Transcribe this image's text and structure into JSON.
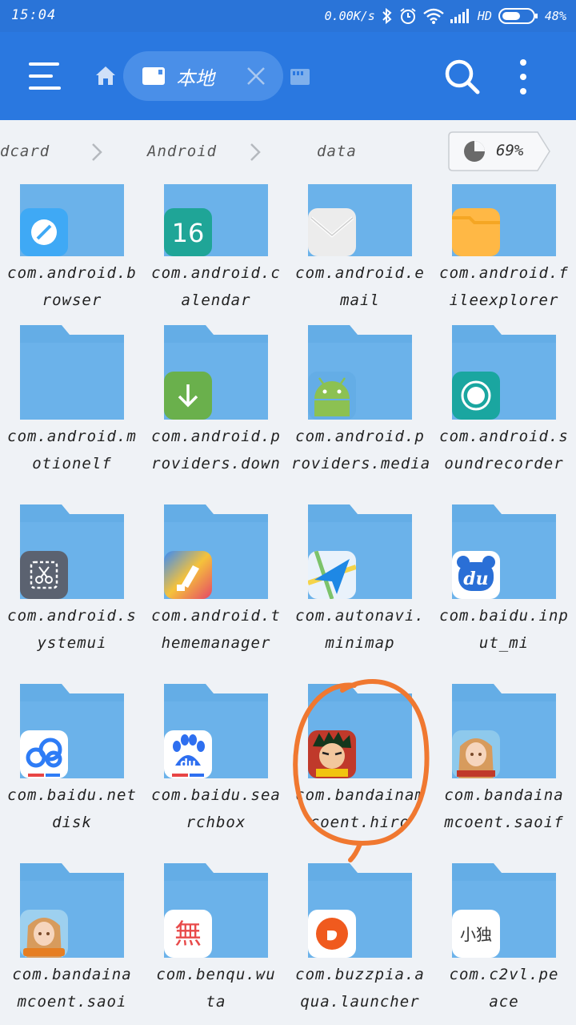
{
  "status_bar": {
    "time": "15:04",
    "speed": "0.00K/s",
    "hd": "HD",
    "battery": "48%"
  },
  "toolbar": {
    "tab_label": "本地"
  },
  "breadcrumb": {
    "items": [
      "dcard",
      "Android",
      "data"
    ],
    "usage": "69%"
  },
  "colors": {
    "toolbar": "#2a78e0",
    "status_bar": "#2a74d8",
    "folder": "#64ade6",
    "background": "#eff2f6",
    "annotation": "#f07830"
  },
  "folders": [
    {
      "line1": "com.android.b",
      "line2": "rowser",
      "icon": "browser-icon"
    },
    {
      "line1": "com.android.c",
      "line2": "alendar",
      "icon": "calendar-icon",
      "icon_text": "16"
    },
    {
      "line1": "com.android.e",
      "line2": "mail",
      "icon": "email-icon"
    },
    {
      "line1": "com.android.f",
      "line2": "ileexplorer",
      "icon": "file-explorer-icon"
    },
    {
      "line1": "com.android.m",
      "line2": "otionelf",
      "icon": "none"
    },
    {
      "line1": "com.android.p",
      "line2": "roviders.down",
      "icon": "download-icon"
    },
    {
      "line1": "com.android.p",
      "line2": "roviders.media",
      "icon": "android-robot-icon"
    },
    {
      "line1": "com.android.s",
      "line2": "oundrecorder",
      "icon": "sound-recorder-icon"
    },
    {
      "line1": "com.android.s",
      "line2": "ystemui",
      "icon": "screenshot-scissors-icon"
    },
    {
      "line1": "com.android.t",
      "line2": "hememanager",
      "icon": "theme-manager-icon"
    },
    {
      "line1": "com.autonavi.",
      "line2": "minimap",
      "icon": "amap-navigation-icon"
    },
    {
      "line1": "com.baidu.inp",
      "line2": "ut_mi",
      "icon": "baidu-input-icon",
      "icon_text": "du"
    },
    {
      "line1": "com.baidu.net",
      "line2": "disk",
      "icon": "baidu-netdisk-icon"
    },
    {
      "line1": "com.baidu.sea",
      "line2": "rchbox",
      "icon": "baidu-search-icon",
      "icon_text": "du"
    },
    {
      "line1": "com.bandainam",
      "line2": "coent.hiro",
      "icon": "anime-hero-game-icon"
    },
    {
      "line1": "com.bandaina",
      "line2": "mcoent.saoif",
      "icon": "sao-game-icon"
    },
    {
      "line1": "com.bandaina",
      "line2": "mcoent.saoi",
      "icon": "sao-major-update-icon"
    },
    {
      "line1": "com.benqu.wu",
      "line2": "ta",
      "icon": "wuta-camera-icon",
      "icon_text": "無"
    },
    {
      "line1": "com.buzzpia.a",
      "line2": "qua.launcher",
      "icon": "buzz-launcher-icon"
    },
    {
      "line1": "com.c2vl.pe",
      "line2": "ace",
      "icon": "peace-app-icon",
      "icon_text": "小独"
    }
  ]
}
